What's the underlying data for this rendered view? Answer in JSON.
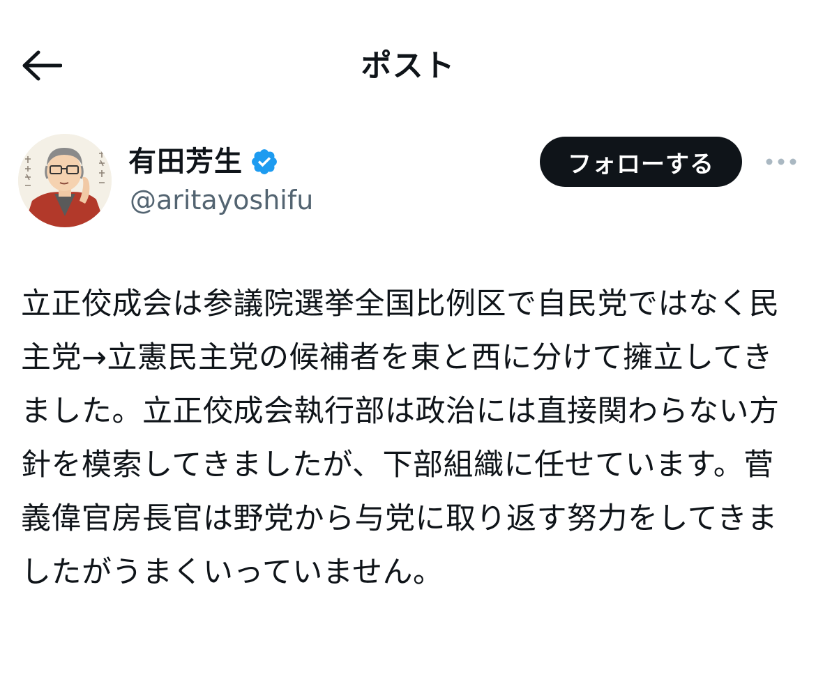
{
  "header": {
    "title": "ポスト",
    "back_icon": "arrow-left-icon"
  },
  "author": {
    "name": "有田芳生",
    "handle": "@aritayoshifu",
    "verified_icon": "verified-badge-icon",
    "avatar_icon": "avatar-illustration",
    "follow_label": "フォローする",
    "more_icon": "more-horizontal-icon"
  },
  "post": {
    "text": "立正佼成会は参議院選挙全国比例区で自民党ではなく民主党→立憲民主党の候補者を東と西に分けて擁立してきました。立正佼成会執行部は政治には直接関わらない方針を模索してきましたが、下部組織に任せています。菅義偉官房長官は野党から与党に取り返す努力をしてきましたがうまくいっていません。"
  },
  "colors": {
    "text": "#0f1419",
    "secondary": "#536471",
    "verified": "#1d9bf0",
    "follow_bg": "#0f1419",
    "follow_text": "#ffffff",
    "background": "#ffffff"
  }
}
